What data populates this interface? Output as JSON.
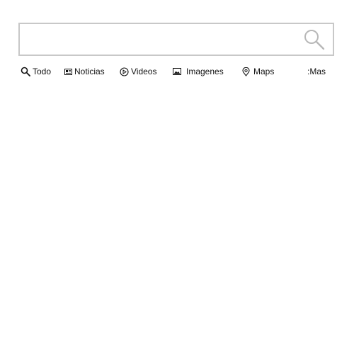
{
  "search": {
    "value": "",
    "placeholder": ""
  },
  "tabs": [
    {
      "label": "Todo",
      "icon": "search-icon"
    },
    {
      "label": "Noticias",
      "icon": "newspaper-icon"
    },
    {
      "label": "Videos",
      "icon": "play-circle-icon"
    },
    {
      "label": "Imagenes",
      "icon": "image-icon"
    },
    {
      "label": "Maps",
      "icon": "map-pin-icon"
    },
    {
      "label": ":Mas",
      "icon": ""
    }
  ],
  "colors": {
    "border": "#c8c8c8",
    "search_icon": "#b8b8b8",
    "text": "#111111"
  }
}
